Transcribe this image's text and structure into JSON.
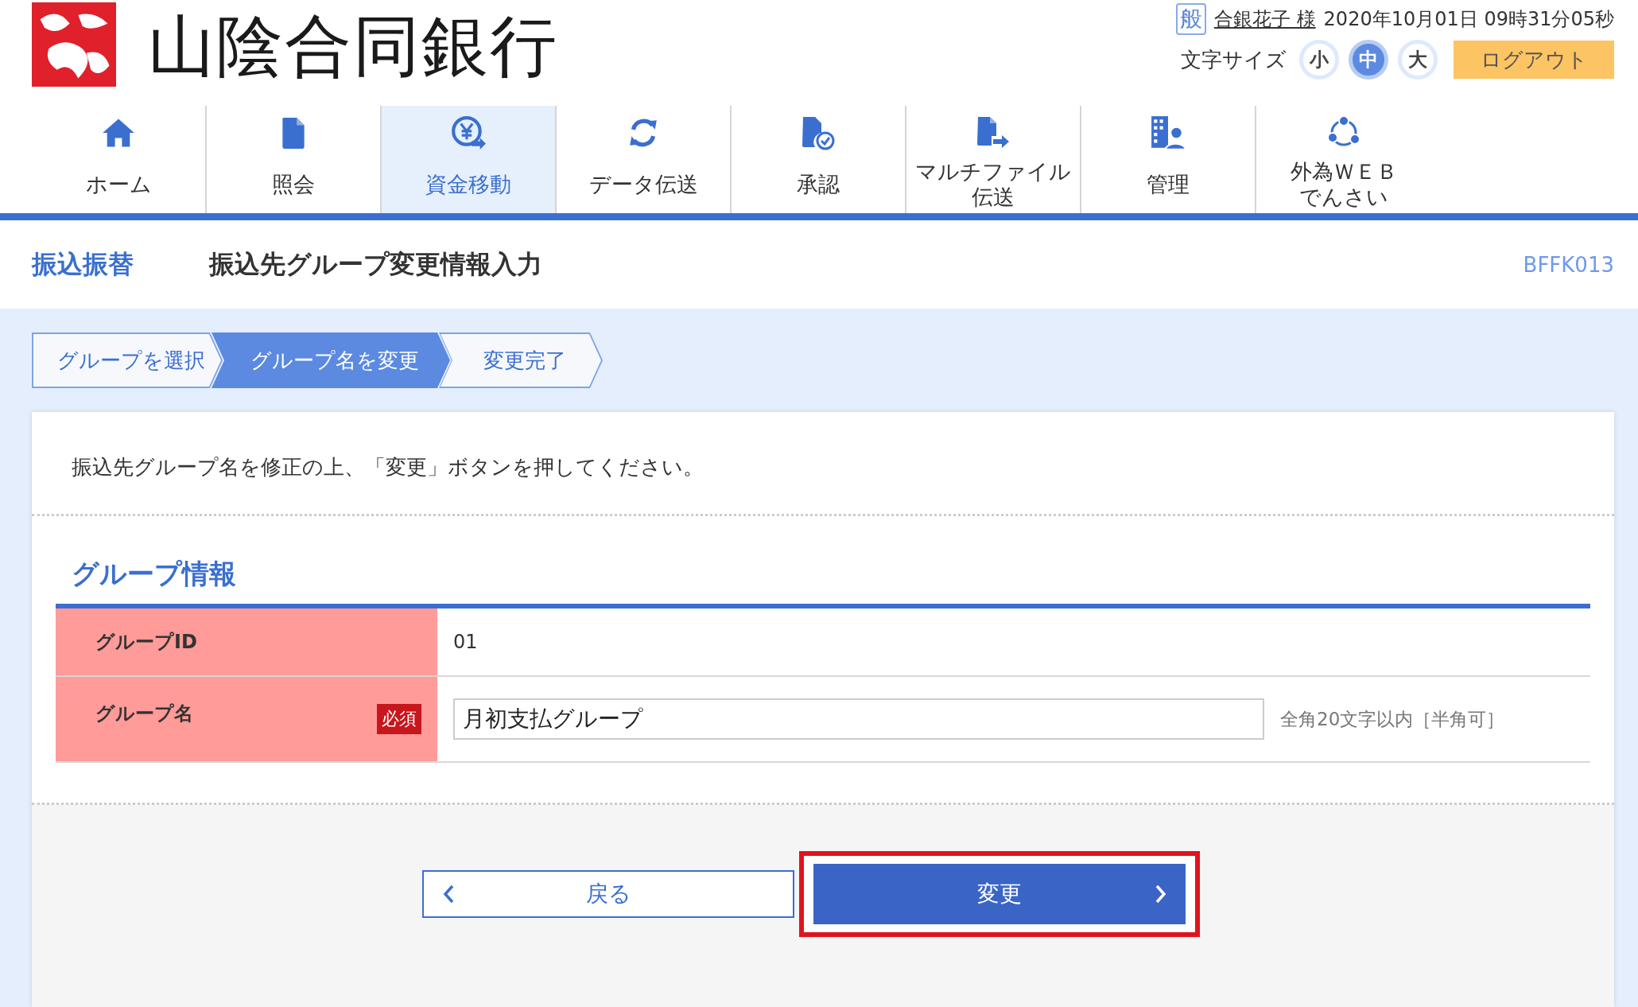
{
  "header": {
    "bank_name": "山陰合同銀行",
    "user_badge": "般",
    "user_name": "合銀花子 様",
    "datetime": "2020年10月01日 09時31分05秒",
    "font_size_label": "文字サイズ",
    "font_sizes": [
      {
        "label": "小",
        "selected": false
      },
      {
        "label": "中",
        "selected": true
      },
      {
        "label": "大",
        "selected": false
      }
    ],
    "logout": "ログアウト"
  },
  "nav": [
    {
      "kind": "home",
      "lines": [
        "ホーム"
      ],
      "selected": false
    },
    {
      "kind": "document",
      "lines": [
        "照会"
      ],
      "selected": false
    },
    {
      "kind": "yen",
      "lines": [
        "資金移動"
      ],
      "selected": true
    },
    {
      "kind": "refresh",
      "lines": [
        "データ伝送"
      ],
      "selected": false
    },
    {
      "kind": "approve",
      "lines": [
        "承認"
      ],
      "selected": false
    },
    {
      "kind": "file-send",
      "lines": [
        "マルチファイル",
        "伝送"
      ],
      "selected": false
    },
    {
      "kind": "admin",
      "lines": [
        "管理"
      ],
      "selected": false
    },
    {
      "kind": "network",
      "lines": [
        "外為ＷＥＢ",
        "でんさい"
      ],
      "selected": false
    }
  ],
  "page_header": {
    "section": "振込振替",
    "title": "振込先グループ変更情報入力",
    "screen_id": "BFFK013"
  },
  "steps": [
    {
      "label": "グループを選択",
      "selected": false
    },
    {
      "label": "グループ名を変更",
      "selected": true
    },
    {
      "label": "変更完了",
      "selected": false
    }
  ],
  "instruction": "振込先グループ名を修正の上、「変更」ボタンを押してください。",
  "section_title": "グループ情報",
  "rows": [
    {
      "kind": "text",
      "label": "グループID",
      "value": "01"
    },
    {
      "kind": "input",
      "label": "グループ名",
      "required_badge": "必須",
      "value": "月初支払グループ",
      "hint": "全角20文字以内［半角可］"
    }
  ],
  "buttons": {
    "back": "戻る",
    "submit": "変更",
    "submit_highlighted": true
  }
}
